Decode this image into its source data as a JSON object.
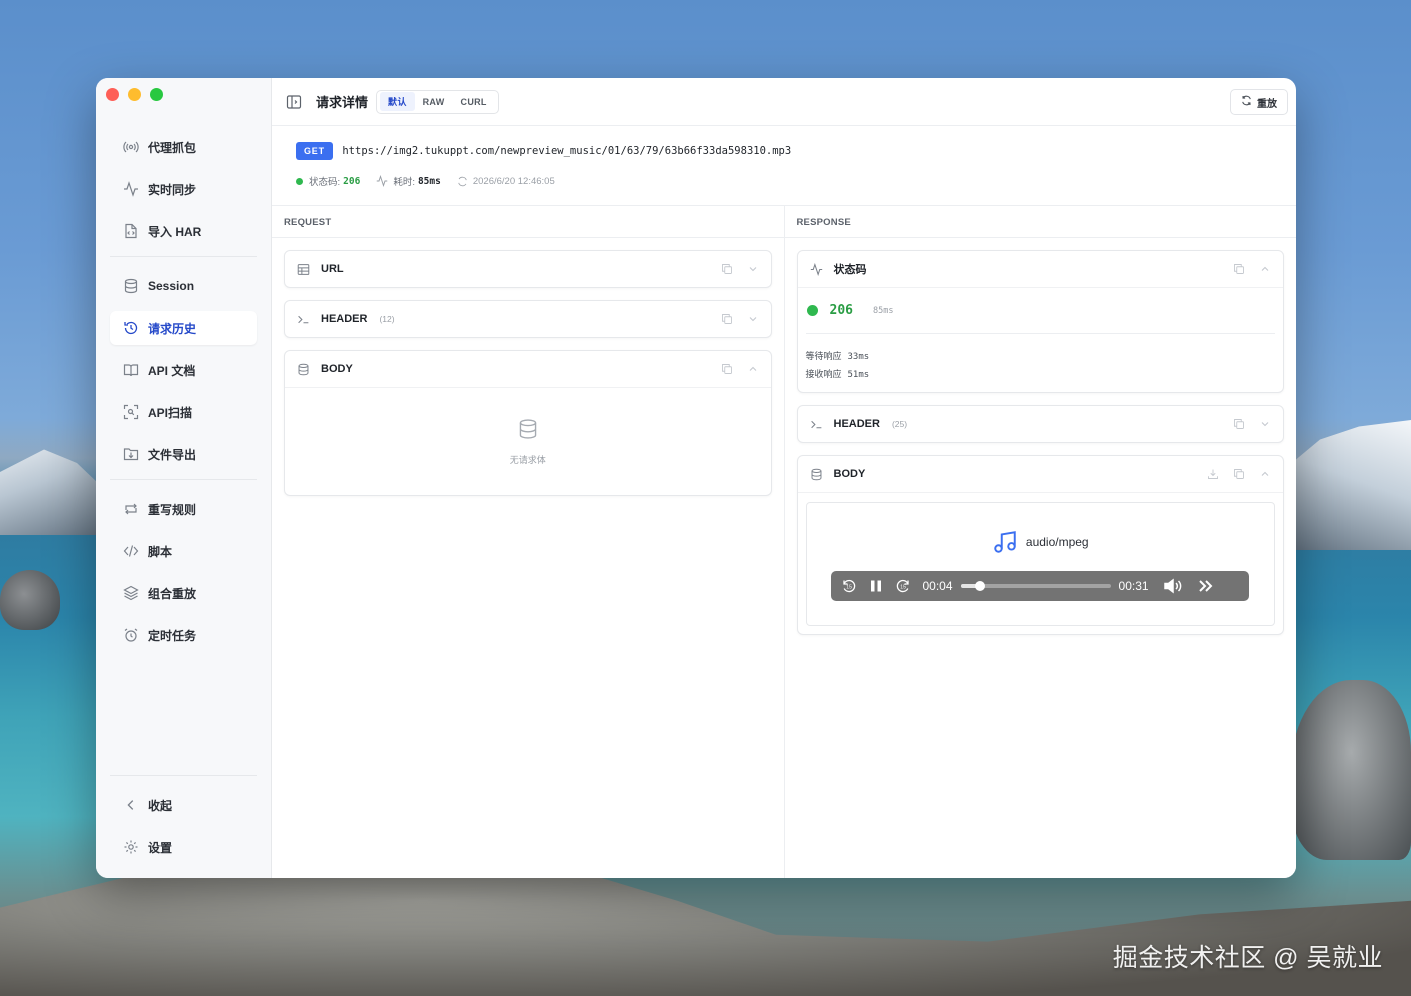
{
  "sidebar": {
    "groups": [
      [
        {
          "label": "代理抓包",
          "icon": "radio-signal-icon",
          "active": false
        },
        {
          "label": "实时同步",
          "icon": "activity-icon",
          "active": false
        },
        {
          "label": "导入 HAR",
          "icon": "file-import-icon",
          "active": false
        }
      ],
      [
        {
          "label": "Session",
          "icon": "database-icon",
          "active": false
        },
        {
          "label": "请求历史",
          "icon": "history-icon",
          "active": true
        },
        {
          "label": "API 文档",
          "icon": "book-icon",
          "active": false
        },
        {
          "label": "API扫描",
          "icon": "scan-icon",
          "active": false
        },
        {
          "label": "文件导出",
          "icon": "folder-export-icon",
          "active": false
        }
      ],
      [
        {
          "label": "重写规则",
          "icon": "repeat-icon",
          "active": false
        },
        {
          "label": "脚本",
          "icon": "code-icon",
          "active": false
        },
        {
          "label": "组合重放",
          "icon": "layers-icon",
          "active": false
        },
        {
          "label": "定时任务",
          "icon": "alarm-icon",
          "active": false
        }
      ]
    ],
    "footer": [
      {
        "label": "收起",
        "icon": "chevron-left-icon"
      },
      {
        "label": "设置",
        "icon": "gear-icon"
      }
    ]
  },
  "header": {
    "title": "请求详情",
    "tabs": [
      {
        "label": "默认",
        "active": true
      },
      {
        "label": "RAW",
        "active": false
      },
      {
        "label": "CURL",
        "active": false
      }
    ],
    "replay_label": "重放"
  },
  "request_summary": {
    "method": "GET",
    "url": "https://img2.tukuppt.com/newpreview_music/01/63/79/63b66f33da598310.mp3",
    "status_label": "状态码:",
    "status_code": "206",
    "duration_label": "耗时:",
    "duration": "85ms",
    "timestamp": "2026/6/20 12:46:05"
  },
  "request": {
    "title": "REQUEST",
    "url_card": {
      "label": "URL"
    },
    "header_card": {
      "label": "HEADER",
      "count": "(12)"
    },
    "body_card": {
      "label": "BODY",
      "empty_text": "无请求体"
    }
  },
  "response": {
    "title": "RESPONSE",
    "status_card": {
      "label": "状态码",
      "code": "206",
      "ms": "85ms",
      "wait_label": "等待响应",
      "wait_value": "33ms",
      "recv_label": "接收响应",
      "recv_value": "51ms"
    },
    "header_card": {
      "label": "HEADER",
      "count": "(25)"
    },
    "body_card": {
      "label": "BODY",
      "mime": "audio/mpeg",
      "player": {
        "current": "00:04",
        "total": "00:31",
        "progress": 0.13
      }
    }
  },
  "watermark": "掘金技术社区 @ 吴就业"
}
